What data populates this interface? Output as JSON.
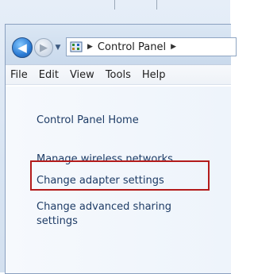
{
  "navigation": {
    "back_icon": "back-arrow-icon",
    "forward_icon": "forward-arrow-icon",
    "recent_icon": "chevron-down-icon"
  },
  "address": {
    "breadcrumb": "Control Panel",
    "icon": "control-panel-icon",
    "separator_icon": "breadcrumb-arrow-icon"
  },
  "menu": {
    "items": [
      "File",
      "Edit",
      "View",
      "Tools",
      "Help"
    ]
  },
  "task_links": {
    "home": "Control Panel Home",
    "manage_wireless": "Manage wireless networks",
    "change_adapter": "Change adapter settings",
    "advanced_sharing_line1": "Change advanced sharing",
    "advanced_sharing_line2": "settings"
  },
  "colors": {
    "highlight_border": "#b31b1b",
    "link_text": "#1e3c66"
  }
}
